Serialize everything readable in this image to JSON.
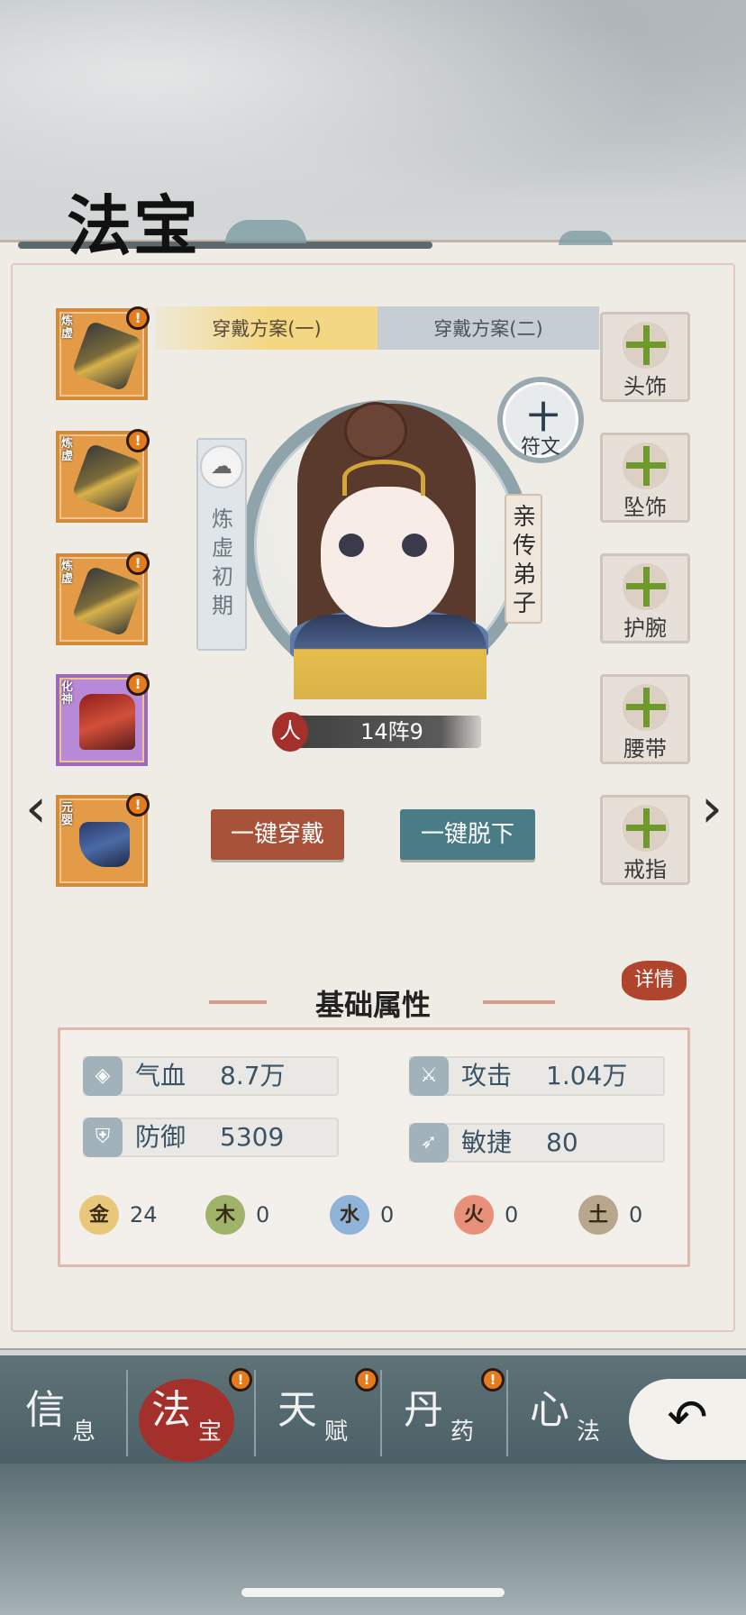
{
  "header": {
    "title": "法宝"
  },
  "plans": {
    "plan1": "穿戴方案(一)",
    "plan2": "穿戴方案(二)"
  },
  "left_slots": [
    {
      "tag": "炼虚",
      "badge": "!"
    },
    {
      "tag": "炼虚",
      "badge": "!"
    },
    {
      "tag": "炼虚",
      "badge": "!"
    },
    {
      "tag": "化神",
      "badge": "!"
    },
    {
      "tag": "元婴",
      "badge": "!"
    }
  ],
  "right_slots": [
    {
      "label": "头饰"
    },
    {
      "label": "坠饰"
    },
    {
      "label": "护腕"
    },
    {
      "label": "腰带"
    },
    {
      "label": "戒指"
    }
  ],
  "character": {
    "rank": "炼虚初期",
    "title": "亲传弟子",
    "race": "人",
    "level": "14阵9"
  },
  "rune": {
    "plus": "十",
    "label": "符文"
  },
  "actions": {
    "wear_all": "一键穿戴",
    "remove_all": "一键脱下"
  },
  "nav_arrows": {
    "left": "‹",
    "right": "›"
  },
  "details": {
    "label": "详情"
  },
  "stats": {
    "section_title": "基础属性",
    "hp": {
      "name": "气血",
      "value": "8.7万"
    },
    "attack": {
      "name": "攻击",
      "value": "1.04万"
    },
    "defense": {
      "name": "防御",
      "value": "5309"
    },
    "agility": {
      "name": "敏捷",
      "value": "80"
    },
    "elements": [
      {
        "glyph": "金",
        "value": "24",
        "color": "#e9c77a"
      },
      {
        "glyph": "木",
        "value": "0",
        "color": "#9fb36b"
      },
      {
        "glyph": "水",
        "value": "0",
        "color": "#8fb3d9"
      },
      {
        "glyph": "火",
        "value": "0",
        "color": "#e8907a"
      },
      {
        "glyph": "土",
        "value": "0",
        "color": "#b7a78c"
      }
    ]
  },
  "bottom_nav": [
    {
      "big": "信",
      "small": "息"
    },
    {
      "big": "法",
      "small": "宝",
      "active": true,
      "badge": "!"
    },
    {
      "big": "天",
      "small": "赋",
      "badge": "!"
    },
    {
      "big": "丹",
      "small": "药",
      "badge": "!"
    },
    {
      "big": "心",
      "small": "法"
    }
  ],
  "back": {
    "label": "↶"
  },
  "icons": [
    "hp-icon",
    "attack-icon",
    "defense-icon",
    "agility-icon",
    "cloud-icon",
    "back-icon"
  ]
}
